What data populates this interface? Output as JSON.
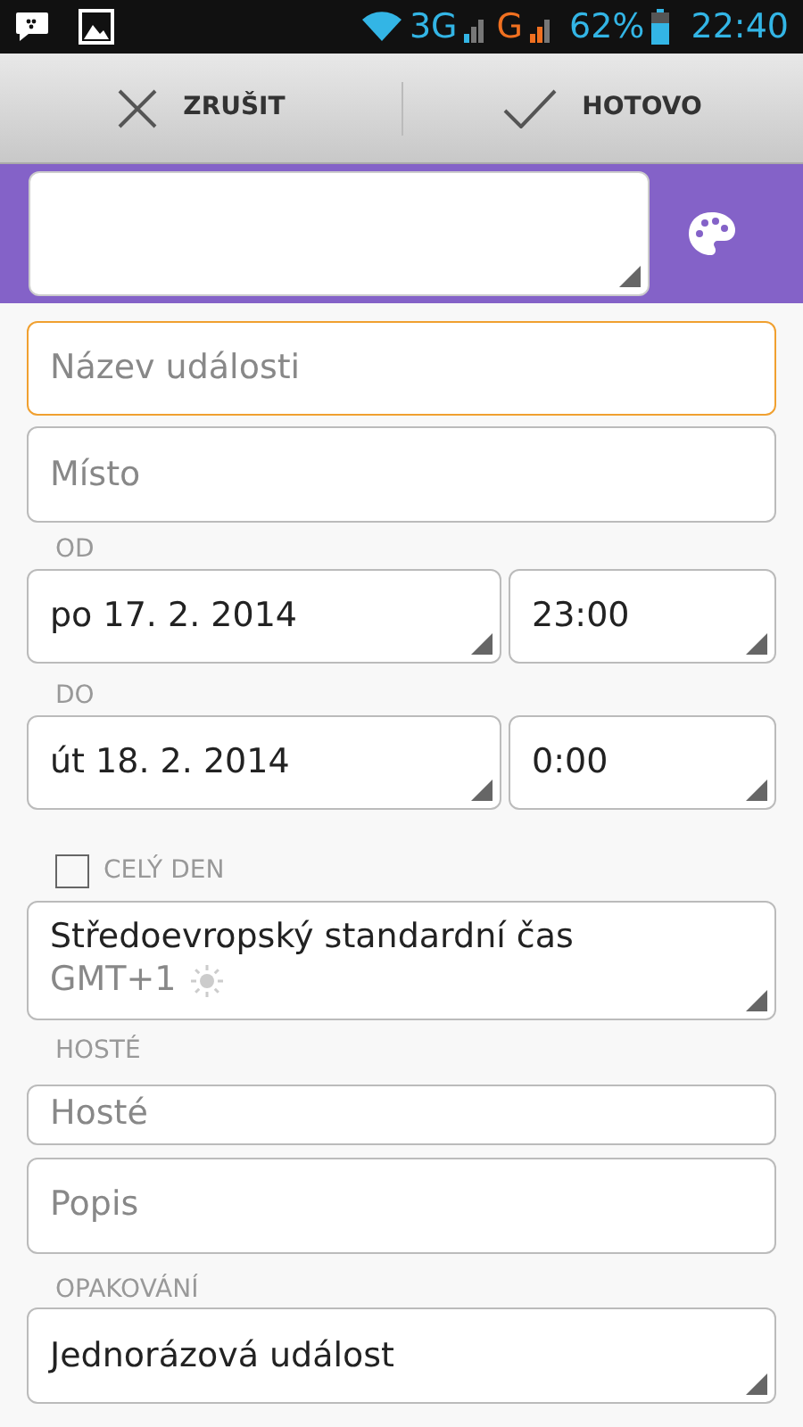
{
  "status_bar": {
    "network_1": "3G",
    "network_2": "G",
    "battery": "62%",
    "time": "22:40"
  },
  "action_bar": {
    "buttons": [
      {
        "label": "ZRUŠIT",
        "kind": "cancel"
      },
      {
        "label": "HOTOVO",
        "kind": "done"
      }
    ]
  },
  "color_band": {
    "color": "#8462c8"
  },
  "title_field": {
    "placeholder": "Název události",
    "focused": true
  },
  "location_field": {
    "placeholder": "Místo"
  },
  "from": {
    "label": "OD",
    "date": "po 17. 2. 2014",
    "time": "23:00"
  },
  "to": {
    "label": "DO",
    "date": "út 18. 2. 2014",
    "time": "0:00"
  },
  "all_day": {
    "label": "CELÝ DEN",
    "checked": false
  },
  "timezone": {
    "name": "Středoevropský standardní čas",
    "offset": "GMT+1"
  },
  "guests": {
    "label": "HOSTÉ",
    "placeholder": "Hosté"
  },
  "description_field": {
    "placeholder": "Popis"
  },
  "repeat": {
    "label": "OPAKOVÁNÍ",
    "value": "Jednorázová událost"
  }
}
